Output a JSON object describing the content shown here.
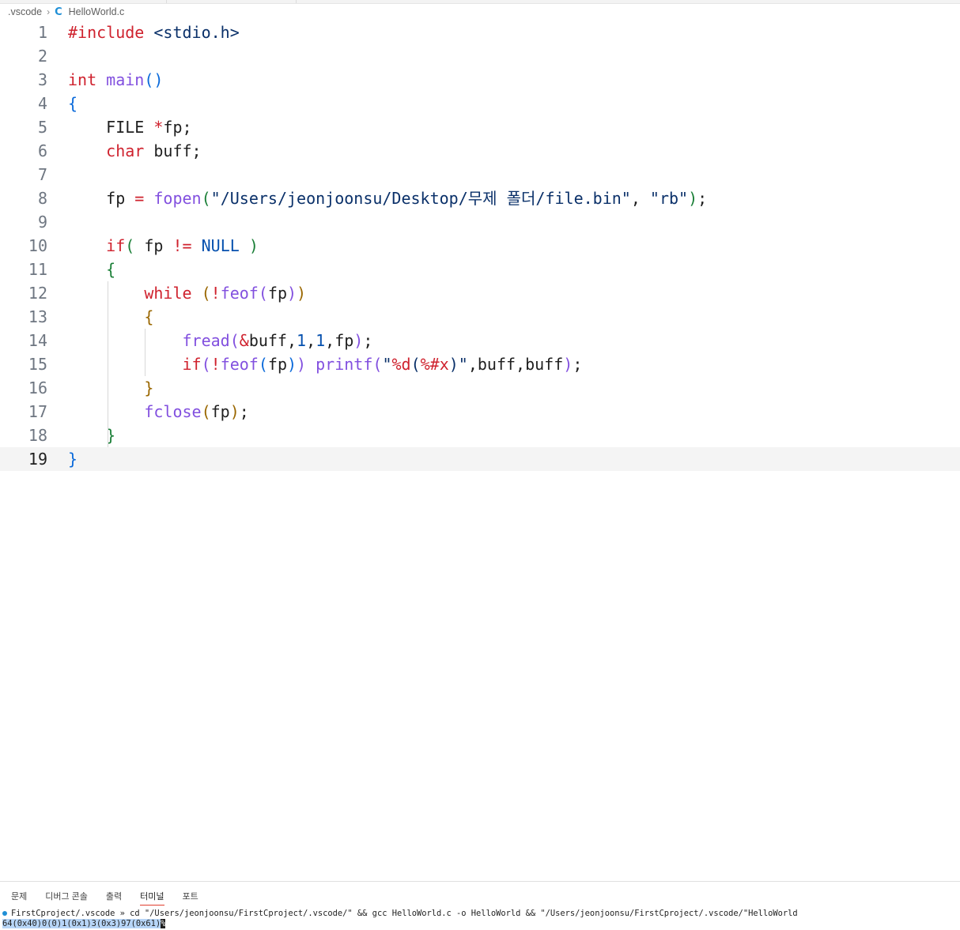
{
  "breadcrumb": {
    "folder": ".vscode",
    "file_icon": "c-icon",
    "file": "HelloWorld.c"
  },
  "editor": {
    "current_line": 19,
    "lines": [
      {
        "n": "1",
        "tokens": [
          {
            "t": "#include",
            "c": "kw-red"
          },
          {
            "t": " "
          },
          {
            "t": "<stdio.h>",
            "c": "str-navy"
          }
        ]
      },
      {
        "n": "2",
        "tokens": []
      },
      {
        "n": "3",
        "tokens": [
          {
            "t": "int",
            "c": "kw-red"
          },
          {
            "t": " "
          },
          {
            "t": "main",
            "c": "kw-purple"
          },
          {
            "t": "()",
            "c": "b1"
          }
        ]
      },
      {
        "n": "4",
        "tokens": [
          {
            "t": "{",
            "c": "b1"
          }
        ]
      },
      {
        "n": "5",
        "tokens": [
          {
            "t": "    FILE "
          },
          {
            "t": "*",
            "c": "kw-red"
          },
          {
            "t": "fp;"
          }
        ]
      },
      {
        "n": "6",
        "tokens": [
          {
            "t": "    "
          },
          {
            "t": "char",
            "c": "kw-red"
          },
          {
            "t": " buff;"
          }
        ]
      },
      {
        "n": "7",
        "tokens": []
      },
      {
        "n": "8",
        "tokens": [
          {
            "t": "    fp "
          },
          {
            "t": "=",
            "c": "kw-red"
          },
          {
            "t": " "
          },
          {
            "t": "fopen",
            "c": "kw-purple"
          },
          {
            "t": "(",
            "c": "b2"
          },
          {
            "t": "\"/Users/jeonjoonsu/Desktop/무제 폴더/file.bin\"",
            "c": "str-navy"
          },
          {
            "t": ", "
          },
          {
            "t": "\"rb\"",
            "c": "str-navy"
          },
          {
            "t": ")",
            "c": "b2"
          },
          {
            "t": ";"
          }
        ]
      },
      {
        "n": "9",
        "tokens": []
      },
      {
        "n": "10",
        "tokens": [
          {
            "t": "    "
          },
          {
            "t": "if",
            "c": "kw-red"
          },
          {
            "t": "(",
            "c": "b2"
          },
          {
            "t": " fp "
          },
          {
            "t": "!=",
            "c": "kw-red"
          },
          {
            "t": " "
          },
          {
            "t": "NULL",
            "c": "kw-blue"
          },
          {
            "t": " "
          },
          {
            "t": ")",
            "c": "b2"
          }
        ]
      },
      {
        "n": "11",
        "tokens": [
          {
            "t": "    "
          },
          {
            "t": "{",
            "c": "b2"
          }
        ]
      },
      {
        "n": "12",
        "tokens": [
          {
            "t": "        "
          },
          {
            "t": "while",
            "c": "kw-red"
          },
          {
            "t": " "
          },
          {
            "t": "(",
            "c": "b3"
          },
          {
            "t": "!",
            "c": "kw-red"
          },
          {
            "t": "feof",
            "c": "kw-purple"
          },
          {
            "t": "(",
            "c": "kw-purple"
          },
          {
            "t": "fp"
          },
          {
            "t": ")",
            "c": "kw-purple"
          },
          {
            "t": ")",
            "c": "b3"
          }
        ]
      },
      {
        "n": "13",
        "tokens": [
          {
            "t": "        "
          },
          {
            "t": "{",
            "c": "b3"
          }
        ]
      },
      {
        "n": "14",
        "tokens": [
          {
            "t": "            "
          },
          {
            "t": "fread",
            "c": "kw-purple"
          },
          {
            "t": "(",
            "c": "kw-purple"
          },
          {
            "t": "&",
            "c": "kw-red"
          },
          {
            "t": "buff,"
          },
          {
            "t": "1",
            "c": "num-blue"
          },
          {
            "t": ","
          },
          {
            "t": "1",
            "c": "num-blue"
          },
          {
            "t": ",fp"
          },
          {
            "t": ")",
            "c": "kw-purple"
          },
          {
            "t": ";"
          }
        ]
      },
      {
        "n": "15",
        "tokens": [
          {
            "t": "            "
          },
          {
            "t": "if",
            "c": "kw-red"
          },
          {
            "t": "(",
            "c": "kw-purple"
          },
          {
            "t": "!",
            "c": "kw-red"
          },
          {
            "t": "feof",
            "c": "kw-purple"
          },
          {
            "t": "(",
            "c": "b1"
          },
          {
            "t": "fp"
          },
          {
            "t": ")",
            "c": "b1"
          },
          {
            "t": ")",
            "c": "kw-purple"
          },
          {
            "t": " "
          },
          {
            "t": "printf",
            "c": "kw-purple"
          },
          {
            "t": "(",
            "c": "kw-purple"
          },
          {
            "t": "\"",
            "c": "str-navy"
          },
          {
            "t": "%d",
            "c": "kw-red"
          },
          {
            "t": "(",
            "c": "str-navy"
          },
          {
            "t": "%#x",
            "c": "kw-red"
          },
          {
            "t": ")\"",
            "c": "str-navy"
          },
          {
            "t": ",buff,buff"
          },
          {
            "t": ")",
            "c": "kw-purple"
          },
          {
            "t": ";"
          }
        ]
      },
      {
        "n": "16",
        "tokens": [
          {
            "t": "        "
          },
          {
            "t": "}",
            "c": "b3"
          }
        ]
      },
      {
        "n": "17",
        "tokens": [
          {
            "t": "        "
          },
          {
            "t": "fclose",
            "c": "kw-purple"
          },
          {
            "t": "(",
            "c": "b3"
          },
          {
            "t": "fp"
          },
          {
            "t": ")",
            "c": "b3"
          },
          {
            "t": ";"
          }
        ]
      },
      {
        "n": "18",
        "tokens": [
          {
            "t": "    "
          },
          {
            "t": "}",
            "c": "b2"
          }
        ]
      },
      {
        "n": "19",
        "tokens": [
          {
            "t": "}",
            "c": "b1"
          }
        ]
      }
    ]
  },
  "panel": {
    "tabs": [
      {
        "label": "문제",
        "active": false
      },
      {
        "label": "디버그 콘솔",
        "active": false
      },
      {
        "label": "출력",
        "active": false
      },
      {
        "label": "터미널",
        "active": true
      },
      {
        "label": "포트",
        "active": false
      }
    ],
    "terminal": {
      "prompt_dir": "FirstCproject/.vscode",
      "prompt_sep": " » ",
      "command": "cd \"/Users/jeonjoonsu/FirstCproject/.vscode/\" && gcc HelloWorld.c -o HelloWorld && \"/Users/jeonjoonsu/FirstCproject/.vscode/\"HelloWorld",
      "output": "64(0x40)0(0)1(0x1)3(0x3)97(0x61)",
      "cursor_char": "%"
    }
  }
}
